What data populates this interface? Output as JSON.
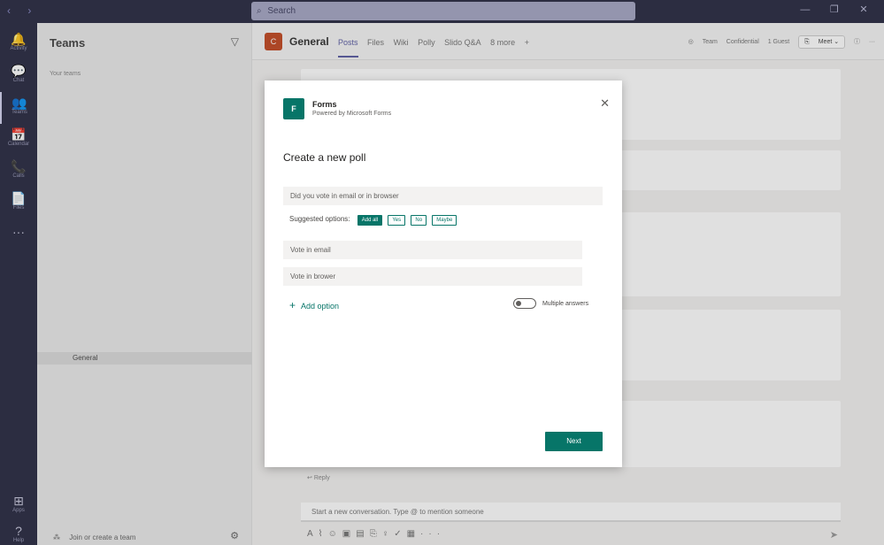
{
  "titlebar": {
    "nav_back": "‹",
    "nav_forward": "›",
    "search_placeholder": "Search",
    "minimize": "—",
    "maximize": "❐",
    "close": "✕"
  },
  "rail": {
    "items": [
      {
        "icon": "bell-icon",
        "glyph": "🔔",
        "label": "Activity"
      },
      {
        "icon": "chat-icon",
        "glyph": "💬",
        "label": "Chat"
      },
      {
        "icon": "teams-icon",
        "glyph": "👥",
        "label": "Teams"
      },
      {
        "icon": "calendar-icon",
        "glyph": "📅",
        "label": "Calendar"
      },
      {
        "icon": "calls-icon",
        "glyph": "📞",
        "label": "Calls"
      },
      {
        "icon": "files-icon",
        "glyph": "📄",
        "label": "Files"
      },
      {
        "icon": "more-icon",
        "glyph": "···",
        "label": ""
      }
    ],
    "apps": {
      "glyph": "⊞",
      "label": "Apps"
    },
    "help": {
      "glyph": "?",
      "label": "Help"
    }
  },
  "teams_pane": {
    "title": "Teams",
    "section": "Your teams",
    "channel": "General",
    "join": "Join or create a team"
  },
  "channel_header": {
    "avatar_letter": "C",
    "name": "General",
    "tabs": [
      "Posts",
      "Files",
      "Wiki",
      "Polly",
      "Slido Q&A",
      "8 more"
    ],
    "team_label": "Team",
    "confidential": "Confidential",
    "guest": "1 Guest",
    "meet": "Meet"
  },
  "conversation": {
    "reply": "Reply",
    "compose_placeholder": "Start a new conversation. Type @ to mention someone"
  },
  "modal": {
    "app_name": "Forms",
    "app_sub": "Powered by Microsoft Forms",
    "heading": "Create a new poll",
    "question": "Did you vote in email or in browser",
    "suggested_label": "Suggested options:",
    "chips": [
      "Add all",
      "Yes",
      "No",
      "Maybe"
    ],
    "options": [
      "Vote in email",
      "Vote in brower"
    ],
    "add_option": "Add option",
    "multiple_answers": "Multiple answers",
    "multiple_answers_on": false,
    "next": "Next"
  },
  "colors": {
    "accent": "#077568",
    "rail": "#33344a",
    "teams_purple": "#6264a7"
  }
}
